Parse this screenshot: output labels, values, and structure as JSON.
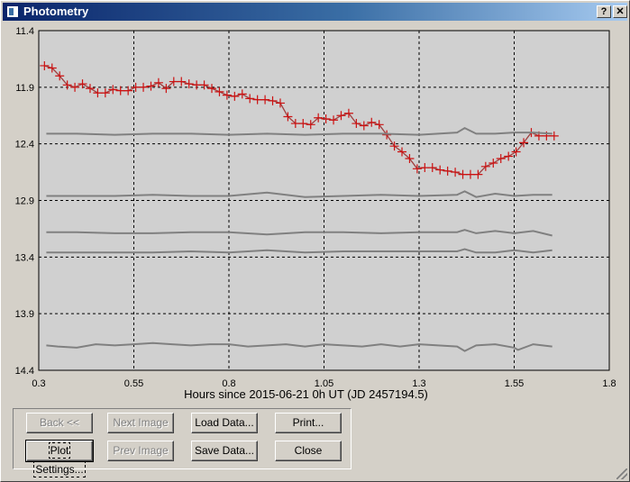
{
  "window": {
    "title": "Photometry",
    "help_label": "?",
    "close_label": "✕",
    "icon": "app-window-icon"
  },
  "buttons": {
    "back": "Back <<",
    "next_image": "Next Image",
    "load_data": "Load Data...",
    "print": "Print...",
    "plot_settings": "Plot Settings...",
    "prev_image": "Prev Image",
    "save_data": "Save Data...",
    "close": "Close"
  },
  "colors": {
    "background": "#d4d0c8",
    "plot_area": "#d0d0d0",
    "target": "#cc1111",
    "target_line": "#a04040",
    "comparison": "#808080",
    "grid": "#000000"
  },
  "chart_data": {
    "type": "line",
    "xlabel": "Hours since 2015-06-21 0h UT (JD 2457194.5)",
    "ylabel": "",
    "xlim": [
      0.3,
      1.8
    ],
    "ylim": [
      14.4,
      11.4
    ],
    "y_inverted": true,
    "x_ticks": [
      0.3,
      0.55,
      0.8,
      1.05,
      1.3,
      1.55,
      1.8
    ],
    "x_tick_labels": [
      "0.3",
      "0.55",
      "0.8",
      "1.05",
      "1.3",
      "1.55",
      "1.8"
    ],
    "y_ticks": [
      11.4,
      11.9,
      12.4,
      12.9,
      13.4,
      13.9,
      14.4
    ],
    "y_tick_labels": [
      "11.4",
      "11.9",
      "12.4",
      "12.9",
      "13.4",
      "13.9",
      "14.4"
    ],
    "grid": true,
    "series": [
      {
        "role": "target",
        "markers": "plus",
        "x": [
          0.315,
          0.335,
          0.355,
          0.375,
          0.395,
          0.415,
          0.435,
          0.455,
          0.475,
          0.495,
          0.515,
          0.535,
          0.555,
          0.575,
          0.595,
          0.615,
          0.635,
          0.655,
          0.675,
          0.695,
          0.715,
          0.735,
          0.755,
          0.775,
          0.795,
          0.815,
          0.835,
          0.855,
          0.875,
          0.895,
          0.915,
          0.935,
          0.955,
          0.975,
          0.995,
          1.015,
          1.035,
          1.055,
          1.075,
          1.095,
          1.115,
          1.135,
          1.155,
          1.175,
          1.195,
          1.215,
          1.235,
          1.255,
          1.275,
          1.295,
          1.315,
          1.335,
          1.355,
          1.375,
          1.395,
          1.415,
          1.435,
          1.455,
          1.475,
          1.495,
          1.515,
          1.535,
          1.555,
          1.575,
          1.595,
          1.615,
          1.635,
          1.655
        ],
        "y": [
          11.71,
          11.73,
          11.8,
          11.88,
          11.9,
          11.87,
          11.91,
          11.95,
          11.95,
          11.92,
          11.93,
          11.93,
          11.9,
          11.9,
          11.89,
          11.86,
          11.91,
          11.85,
          11.85,
          11.87,
          11.88,
          11.88,
          11.91,
          11.94,
          11.97,
          11.98,
          11.96,
          12.0,
          12.01,
          12.01,
          12.02,
          12.04,
          12.16,
          12.22,
          12.22,
          12.23,
          12.17,
          12.18,
          12.19,
          12.15,
          12.13,
          12.22,
          12.24,
          12.21,
          12.23,
          12.32,
          12.42,
          12.47,
          12.53,
          12.62,
          12.61,
          12.61,
          12.63,
          12.64,
          12.65,
          12.67,
          12.67,
          12.67,
          12.6,
          12.57,
          12.53,
          12.51,
          12.47,
          12.39,
          12.3,
          12.33,
          12.33,
          12.33
        ]
      },
      {
        "role": "comparison",
        "x": [
          0.32,
          0.4,
          0.5,
          0.6,
          0.7,
          0.8,
          0.9,
          1.0,
          1.1,
          1.2,
          1.3,
          1.4,
          1.42,
          1.45,
          1.5,
          1.55,
          1.6,
          1.65
        ],
        "y": [
          12.31,
          12.31,
          12.32,
          12.31,
          12.31,
          12.32,
          12.31,
          12.32,
          12.31,
          12.31,
          12.32,
          12.3,
          12.26,
          12.31,
          12.31,
          12.3,
          12.3,
          12.31
        ]
      },
      {
        "role": "comparison",
        "x": [
          0.32,
          0.4,
          0.5,
          0.6,
          0.7,
          0.8,
          0.9,
          1.0,
          1.1,
          1.2,
          1.3,
          1.4,
          1.42,
          1.45,
          1.5,
          1.55,
          1.6,
          1.65
        ],
        "y": [
          12.86,
          12.86,
          12.86,
          12.85,
          12.86,
          12.86,
          12.83,
          12.87,
          12.86,
          12.85,
          12.86,
          12.85,
          12.82,
          12.87,
          12.84,
          12.86,
          12.85,
          12.85
        ]
      },
      {
        "role": "comparison",
        "x": [
          0.32,
          0.4,
          0.5,
          0.6,
          0.7,
          0.8,
          0.9,
          1.0,
          1.1,
          1.2,
          1.3,
          1.4,
          1.42,
          1.45,
          1.5,
          1.55,
          1.6,
          1.65
        ],
        "y": [
          13.18,
          13.18,
          13.19,
          13.19,
          13.18,
          13.18,
          13.2,
          13.18,
          13.18,
          13.19,
          13.18,
          13.18,
          13.16,
          13.19,
          13.17,
          13.19,
          13.17,
          13.21
        ]
      },
      {
        "role": "comparison",
        "x": [
          0.32,
          0.4,
          0.5,
          0.6,
          0.7,
          0.8,
          0.9,
          1.0,
          1.1,
          1.2,
          1.3,
          1.4,
          1.42,
          1.45,
          1.5,
          1.55,
          1.6,
          1.65
        ],
        "y": [
          13.36,
          13.36,
          13.36,
          13.36,
          13.35,
          13.36,
          13.34,
          13.36,
          13.35,
          13.35,
          13.35,
          13.35,
          13.33,
          13.36,
          13.36,
          13.34,
          13.36,
          13.34
        ]
      },
      {
        "role": "comparison",
        "x": [
          0.32,
          0.35,
          0.4,
          0.45,
          0.5,
          0.55,
          0.6,
          0.65,
          0.7,
          0.75,
          0.8,
          0.85,
          0.9,
          0.95,
          1.0,
          1.05,
          1.1,
          1.15,
          1.2,
          1.25,
          1.3,
          1.35,
          1.4,
          1.42,
          1.45,
          1.5,
          1.55,
          1.56,
          1.6,
          1.65
        ],
        "y": [
          14.18,
          14.19,
          14.2,
          14.17,
          14.18,
          14.17,
          14.16,
          14.17,
          14.18,
          14.17,
          14.17,
          14.19,
          14.18,
          14.17,
          14.19,
          14.17,
          14.18,
          14.19,
          14.17,
          14.19,
          14.17,
          14.18,
          14.19,
          14.23,
          14.18,
          14.17,
          14.2,
          14.22,
          14.17,
          14.19
        ]
      }
    ]
  }
}
